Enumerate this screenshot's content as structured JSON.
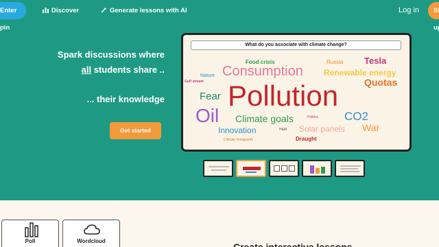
{
  "nav": {
    "pin_label": "Enter pin",
    "discover_label": "Discover",
    "generate_label": "Generate lessons with AI",
    "login_label": "Log in",
    "signup_label": "Sign up"
  },
  "hero": {
    "line1": "Spark discussions where",
    "line2_underlined": "all",
    "line2_rest": " students share ..",
    "line3": "... their knowledge",
    "cta_label": "Get started"
  },
  "preview": {
    "question": "What do you associate with climate change?",
    "words": [
      {
        "text": "Pollution",
        "color": "#c0272d"
      },
      {
        "text": "Consumption",
        "color": "#e8789b"
      },
      {
        "text": "Oil",
        "color": "#9b59d0"
      },
      {
        "text": "Climate goals",
        "color": "#2e9b4f"
      },
      {
        "text": "CO2",
        "color": "#2a8fd0"
      },
      {
        "text": "Innovation",
        "color": "#2a8fd0"
      },
      {
        "text": "Solar panels",
        "color": "#f2a7a0"
      },
      {
        "text": "War",
        "color": "#f39a3a"
      },
      {
        "text": "Quotas",
        "color": "#e8702a"
      },
      {
        "text": "Tesla",
        "color": "#c0397a"
      },
      {
        "text": "Renewable energy",
        "color": "#f2c84b"
      },
      {
        "text": "Fear",
        "color": "#1e8a6e"
      },
      {
        "text": "Food crisis",
        "color": "#2e9b4f"
      },
      {
        "text": "Russia",
        "color": "#e8902a"
      },
      {
        "text": "Nature",
        "color": "#2a8fd0"
      },
      {
        "text": "Gulf stream",
        "color": "#c0397a"
      },
      {
        "text": "Draught",
        "color": "#c0272d"
      },
      {
        "text": "H&M",
        "color": "#555555"
      },
      {
        "text": "Politics",
        "color": "#c0397a"
      },
      {
        "text": "Climate immigrants",
        "color": "#e8702a"
      }
    ]
  },
  "cards": [
    {
      "label": "Poll",
      "icon": "bar-chart-icon"
    },
    {
      "label": "Wordcloud",
      "icon": "cloud-icon"
    }
  ],
  "section_title": "Create interactive lessons"
}
